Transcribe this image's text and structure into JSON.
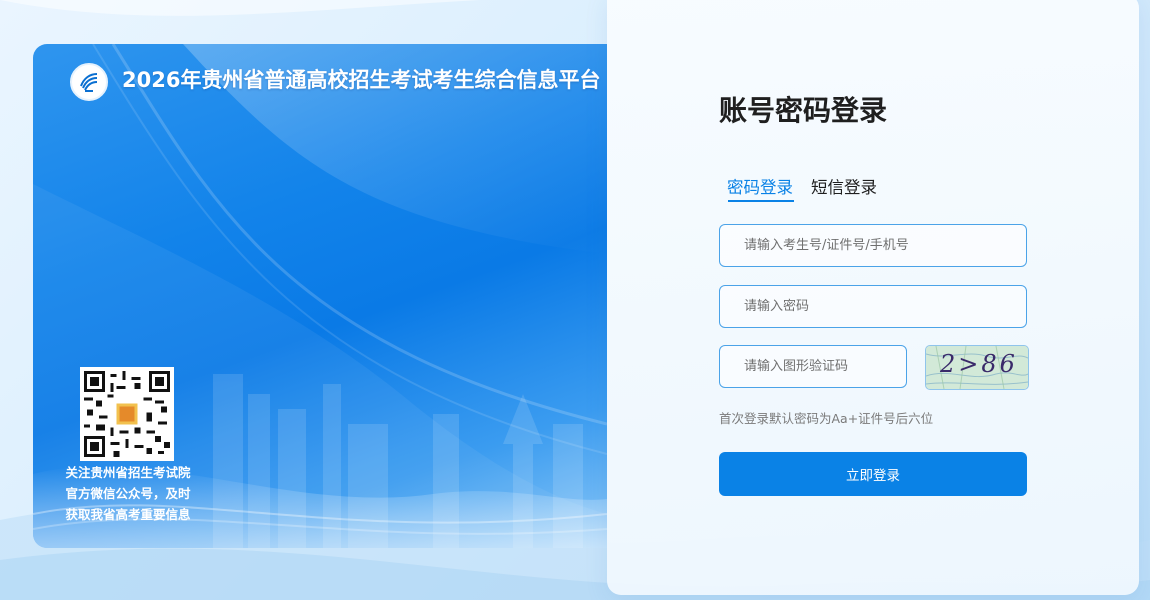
{
  "banner": {
    "title": "2026年贵州省普通高校招生考试考生综合信息平台",
    "logo_icon": "guizhou-exam-logo-icon",
    "qr_icon": "wechat-qr-code-icon",
    "qr_caption_lines": [
      "关注贵州省招生考试院",
      "官方微信公众号，及时",
      "获取我省高考重要信息"
    ]
  },
  "login": {
    "title": "账号密码登录",
    "tabs": [
      {
        "label": "密码登录",
        "active": true
      },
      {
        "label": "短信登录",
        "active": false
      }
    ],
    "account_placeholder": "请输入考生号/证件号/手机号",
    "password_placeholder": "请输入密码",
    "captcha_placeholder": "请输入图形验证码",
    "captcha_text": "2>86",
    "hint": "首次登录默认密码为Aa+证件号后六位",
    "submit_label": "立即登录"
  },
  "colors": {
    "accent": "#0a82e6",
    "banner_blue": "#1283ea",
    "input_border": "#4ba3e8"
  }
}
